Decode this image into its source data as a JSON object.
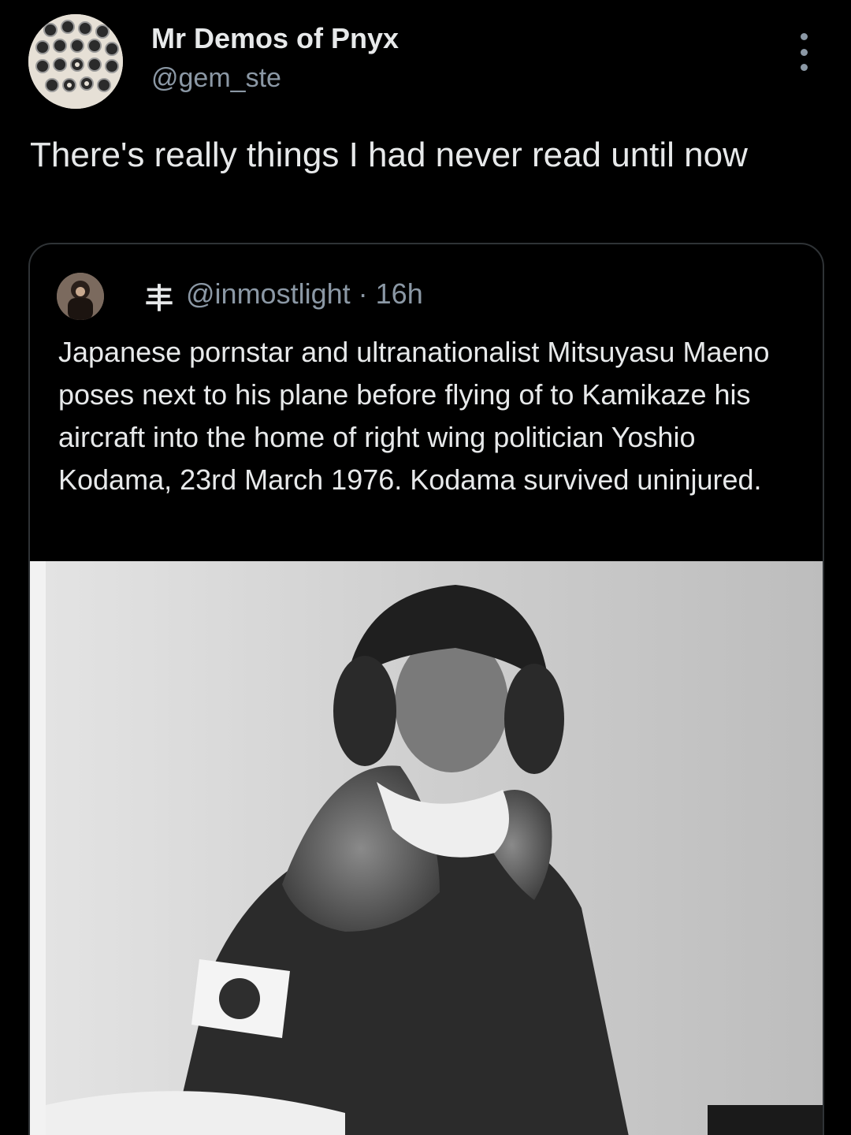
{
  "tweet": {
    "author": {
      "display_name": "Mr Demos of Pnyx",
      "handle": "@gem_ste",
      "avatar_icon": "avatar-image"
    },
    "text": "There's really things I had never read until now",
    "more_icon": "more-dots-icon"
  },
  "quote": {
    "author_glyph": "丰",
    "handle": "@inmostlight",
    "separator": "·",
    "time": "16h",
    "text": "Japanese pornstar and ultranationalist Mitsuyasu Maeno poses next to his plane before flying of to Kamikaze his aircraft into the home of right wing politician Yoshio Kodama, 23rd March 1976. Kodama survived uninjured.",
    "photo": "black-and-white photo of a man in a fur-lined flight cap and jacket with a rising-sun armband"
  },
  "colors": {
    "background": "#000000",
    "text": "#e7e9ea",
    "secondary_text": "#8b98a5",
    "border": "#2f3336"
  }
}
